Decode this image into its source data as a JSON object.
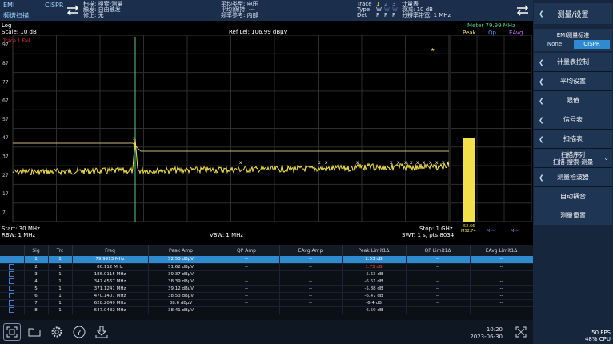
{
  "header": {
    "mode_emi": "EMI",
    "mode_cispr": "CISPR",
    "mode_sub": "频谱扫描",
    "scan_line1": "扫描: 搜索-测量",
    "scan_line2": "触发: 自由触发",
    "scan_line3": "修正: 无",
    "avg_type": "平均类型: 电压",
    "avg_hold": "平均|保持: ---",
    "freq_ref": "频率参考: 内部",
    "trace_label": "Trace",
    "trace_nums": [
      "1",
      "2",
      "3"
    ],
    "type_label": "Type",
    "type_vals": [
      "W",
      "W",
      "W"
    ],
    "det_label": "Det",
    "det_vals": [
      "P",
      "P",
      "P"
    ],
    "meter_line1": "计量表",
    "meter_line2": "衰减: 10 dB",
    "meter_line3": "分辨率带宽: 1 MHz"
  },
  "plot": {
    "scale_type": "Log",
    "scale": "Scale: 10 dB",
    "ref_level": "Ref Lel: 106.99 dBμV",
    "meter_freq": "Meter  79.99 MHz",
    "trace_fail": "Trace 1 Fail",
    "y_ticks": [
      "97",
      "87",
      "77",
      "67",
      "57",
      "47",
      "37",
      "27",
      "17",
      "7"
    ],
    "meter_tabs": [
      "Peak",
      "Qp",
      "EAvg"
    ],
    "meter_peak_value": "52.66",
    "meter_peak_sub": "M52.74",
    "meter_qp_value": "M---",
    "meter_eavg_value": "M---",
    "start": "Start: 30 MHz",
    "rbw": "RBW: 1 MHz",
    "vbw": "VBW: 1 MHz",
    "stop": "Stop: 1 GHz",
    "swt": "SWT: 1 s,  pts:8034"
  },
  "table": {
    "headers": [
      "",
      "Sig",
      "Trc",
      "Freq",
      "Peak Amp",
      "QP Amp",
      "EAvg Amp",
      "Peak Limit1Δ",
      "QP Limit1Δ",
      "EAvg Limit1Δ"
    ],
    "rows": [
      {
        "sig": "1",
        "trc": "1",
        "freq": "79.9913 MHz",
        "peak": "52.53 dBμV",
        "qp": "--",
        "eavg": "--",
        "pl": "2.53 dB",
        "qpl": "--",
        "eavgl": "--"
      },
      {
        "sig": "2",
        "trc": "1",
        "freq": "80.112 MHz",
        "peak": "51.62 dBμV",
        "qp": "--",
        "eavg": "--",
        "pl": "1.73 dB",
        "qpl": "--",
        "eavgl": "--"
      },
      {
        "sig": "3",
        "trc": "1",
        "freq": "186.0115 MHz",
        "peak": "39.37 dBμV",
        "qp": "--",
        "eavg": "--",
        "pl": "-5.63 dB",
        "qpl": "--",
        "eavgl": "--"
      },
      {
        "sig": "4",
        "trc": "1",
        "freq": "347.4567 MHz",
        "peak": "38.39 dBμV",
        "qp": "--",
        "eavg": "--",
        "pl": "-6.61 dB",
        "qpl": "--",
        "eavgl": "--"
      },
      {
        "sig": "5",
        "trc": "1",
        "freq": "371.1241 MHz",
        "peak": "39.12 dBμV",
        "qp": "--",
        "eavg": "--",
        "pl": "-5.88 dB",
        "qpl": "--",
        "eavgl": "--"
      },
      {
        "sig": "6",
        "trc": "1",
        "freq": "470.1407 MHz",
        "peak": "38.53 dBμV",
        "qp": "--",
        "eavg": "--",
        "pl": "-6.47 dB",
        "qpl": "--",
        "eavgl": "--"
      },
      {
        "sig": "7",
        "trc": "1",
        "freq": "628.2049 MHz",
        "peak": "38.6 dBμV",
        "qp": "--",
        "eavg": "--",
        "pl": "-6.4 dB",
        "qpl": "--",
        "eavgl": "--"
      },
      {
        "sig": "8",
        "trc": "1",
        "freq": "647.0432 MHz",
        "peak": "38.41 dBμV",
        "qp": "--",
        "eavg": "--",
        "pl": "-6.59 dB",
        "qpl": "--",
        "eavgl": "--"
      }
    ]
  },
  "right_panel": {
    "title": "测量/设置",
    "standard_label": "EMI测量标准",
    "std_none": "None",
    "std_cispr": "CISPR",
    "items": [
      "计量表控制",
      "平均设置",
      "限值",
      "信号表",
      "扫描表",
      "扫描序列\n扫描-搜索-测量",
      "测量检波器",
      "自动耦合",
      "测量重置"
    ]
  },
  "taskbar": {
    "time": "10:20",
    "date": "2023-06-30",
    "fps": "50 FPS",
    "cpu": "48% CPU",
    "icons": [
      "screenshot-icon",
      "folder-icon",
      "settings-icon",
      "help-icon",
      "download-icon"
    ]
  },
  "colors": {
    "trace": "#f2e04a",
    "limit": "#c8b87a",
    "marker": "#4fd18a",
    "accent": "#2e8bd0",
    "header_bg": "#1b2f4d"
  }
}
